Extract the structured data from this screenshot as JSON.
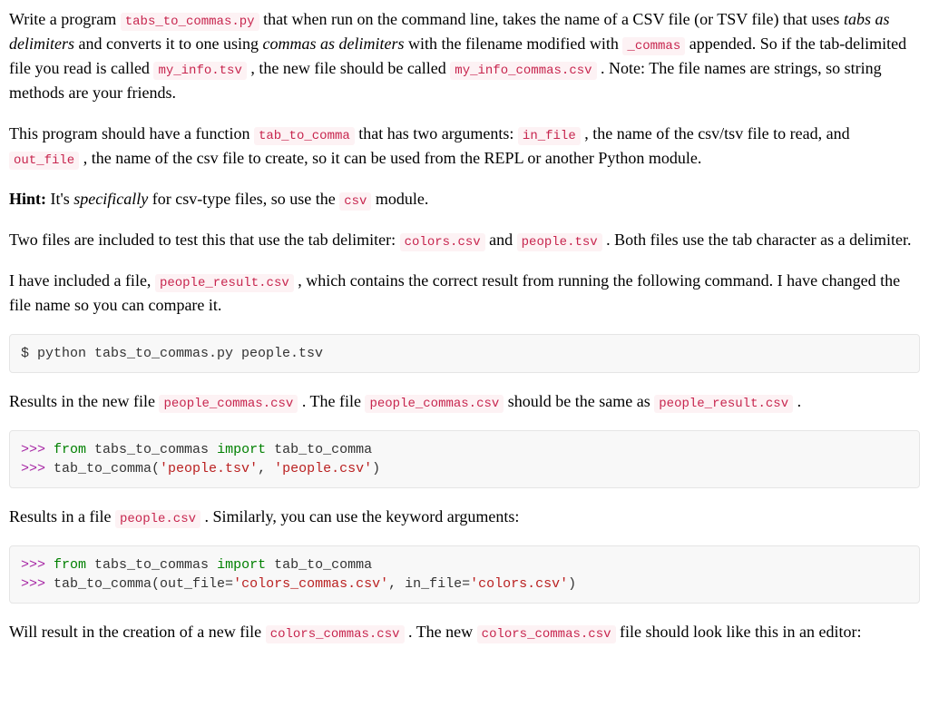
{
  "para1": {
    "t1": "Write a program ",
    "c1": "tabs_to_commas.py",
    "t2": " that when run on the command line, takes the name of a CSV file (or TSV file) that uses ",
    "i1": "tabs as delimiters",
    "t3": " and converts it to one using ",
    "i2": "commas as delimiters",
    "t4": " with the filename modified with ",
    "c2": "_commas",
    "t5": " appended. So if the tab-delimited file you read is called ",
    "c3": "my_info.tsv",
    "t6": " , the new file should be called ",
    "c4": "my_info_commas.csv",
    "t7": " . Note: The file names are strings, so string methods are your friends."
  },
  "para2": {
    "t1": "This program should have a function ",
    "c1": "tab_to_comma",
    "t2": " that has two arguments: ",
    "c2": "in_file",
    "t3": " , the name of the csv/tsv file to read, and ",
    "c3": "out_file",
    "t4": " , the name of the csv file to create, so it can be used from the REPL or another Python module."
  },
  "para3": {
    "b1": "Hint:",
    "t1": " It's ",
    "i1": "specifically",
    "t2": " for csv-type files, so use the ",
    "c1": "csv",
    "t3": " module."
  },
  "para4": {
    "t1": "Two files are included to test this that use the tab delimiter: ",
    "c1": "colors.csv",
    "t2": " and ",
    "c2": "people.tsv",
    "t3": " . Both files use the tab character as a delimiter."
  },
  "para5": {
    "t1": "I have included a file, ",
    "c1": "people_result.csv",
    "t2": " , which contains the correct result from running the following command. I have changed the file name so you can compare it."
  },
  "code1": {
    "line": "$ python tabs_to_commas.py people.tsv"
  },
  "para6": {
    "t1": "Results in the new file ",
    "c1": "people_commas.csv",
    "t2": " . The file ",
    "c2": "people_commas.csv",
    "t3": " should be the same as ",
    "c3": "people_result.csv",
    "t4": " ."
  },
  "code2": {
    "prompt1": ">>> ",
    "kw_from1": "from",
    "mod1": " tabs_to_commas ",
    "kw_import1": "import",
    "name1": " tab_to_comma",
    "prompt2": ">>> ",
    "call2a": "tab_to_comma(",
    "str2a": "'people.tsv'",
    "sep2": ", ",
    "str2b": "'people.csv'",
    "call2b": ")"
  },
  "para7": {
    "t1": "Results in a file ",
    "c1": "people.csv",
    "t2": " . Similarly, you can use the keyword arguments:"
  },
  "code3": {
    "prompt1": ">>> ",
    "kw_from1": "from",
    "mod1": " tabs_to_commas ",
    "kw_import1": "import",
    "name1": " tab_to_comma",
    "prompt2": ">>> ",
    "call2a": "tab_to_comma(out_file=",
    "str2a": "'colors_commas.csv'",
    "sep2": ", in_file=",
    "str2b": "'colors.csv'",
    "call2b": ")"
  },
  "para8": {
    "t1": "Will result in the creation of a new file ",
    "c1": "colors_commas.csv",
    "t2": " . The new ",
    "c2": "colors_commas.csv",
    "t3": " file should look like this in an editor:"
  }
}
